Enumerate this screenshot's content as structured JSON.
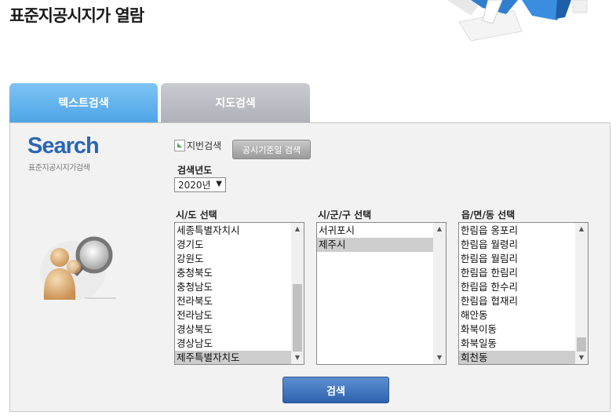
{
  "page_title": "표준지공시지가 열람",
  "tabs": [
    {
      "label": "텍스트검색",
      "active": true
    },
    {
      "label": "지도검색",
      "active": false
    }
  ],
  "logo": {
    "search": "Search",
    "subtitle": "표준지공시지가검색"
  },
  "broken_image_alt": "지번검색",
  "date_button": "공시기준일 검색",
  "year": {
    "label": "검색년도",
    "selected": "2020년"
  },
  "sido": {
    "label": "시/도 선택",
    "items": [
      "세종특별자치시",
      "경기도",
      "강원도",
      "충청북도",
      "충청남도",
      "전라북도",
      "전라남도",
      "경상북도",
      "경상남도",
      "제주특별자치도"
    ],
    "selected_index": 9
  },
  "sigungu": {
    "label": "시/군/구 선택",
    "items": [
      "서귀포시",
      "제주시"
    ],
    "selected_index": 1
  },
  "eupmyeondong": {
    "label": "읍/면/동 선택",
    "items": [
      "한림읍 옹포리",
      "한림읍 월령리",
      "한림읍 월림리",
      "한림읍 한림리",
      "한림읍 한수리",
      "한림읍 협재리",
      "해안동",
      "화북이동",
      "화북일동",
      "회천동"
    ],
    "selected_index": 9
  },
  "search_button": "검색",
  "colors": {
    "tab_active": "#5aaeec",
    "tab_inactive": "#b9bbc1",
    "search_logo": "#2a67b5",
    "search_button": "#3a6fbb"
  }
}
